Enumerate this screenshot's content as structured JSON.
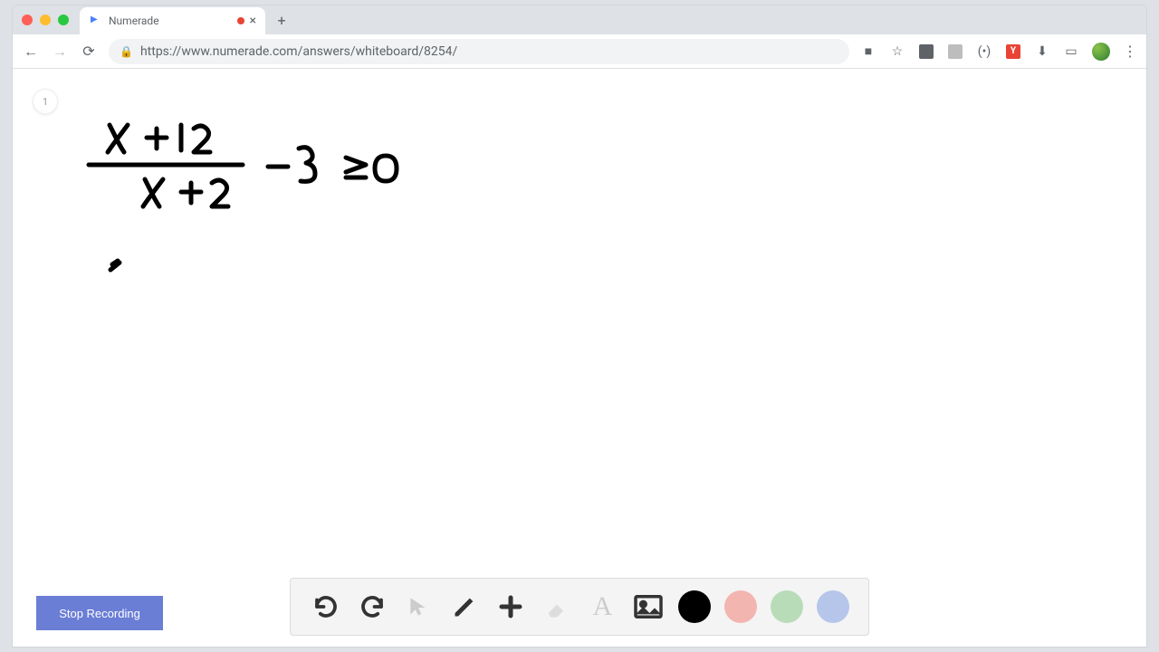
{
  "browser": {
    "tab_title": "Numerade",
    "url": "https://www.numerade.com/answers/whiteboard/8254/",
    "new_tab_label": "+",
    "tab_close_label": "×",
    "more_label": "⋮"
  },
  "page": {
    "marker": "1",
    "stop_recording_label": "Stop Recording",
    "equation_numerator": "x + 12",
    "equation_denominator": "x + 2",
    "equation_rhs": "- 3 ≥ 0"
  },
  "toolbar": {
    "undo_label": "↺",
    "redo_label": "↻",
    "pointer_label": "↖",
    "pen_label": "✎",
    "plus_label": "＋",
    "eraser_label": "⌫",
    "text_label": "A",
    "image_label": "🖼"
  },
  "colors": {
    "black": "#000000",
    "red": "#f3b5b0",
    "green": "#b8dcb8",
    "blue": "#b6c5ea"
  }
}
